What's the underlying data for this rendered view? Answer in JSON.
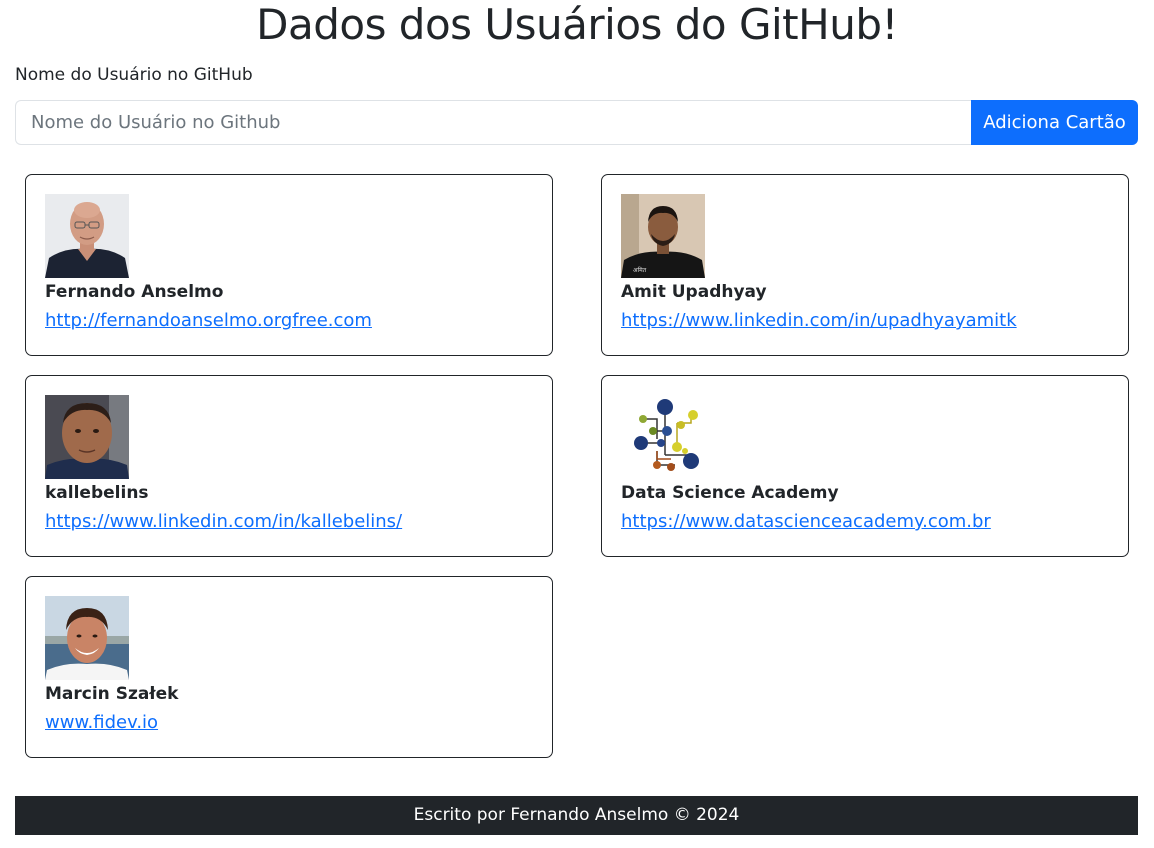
{
  "header": {
    "title": "Dados dos Usuários do GitHub!"
  },
  "form": {
    "label": "Nome do Usuário no GitHub",
    "input_placeholder": "Nome do Usuário no Github",
    "input_value": "",
    "add_button_label": "Adiciona Cartão"
  },
  "cards": [
    {
      "name": "Fernando Anselmo",
      "link": "http://fernandoanselmo.orgfree.com",
      "avatar": "avatar-photo-bald-man-glasses"
    },
    {
      "name": "Amit Upadhyay",
      "link": "https://www.linkedin.com/in/upadhyayamitk",
      "avatar": "avatar-photo-young-man"
    },
    {
      "name": "kallebelins",
      "link": "https://www.linkedin.com/in/kallebelins/",
      "avatar": "avatar-photo-man-closeup"
    },
    {
      "name": "Data Science Academy",
      "link": "https://www.datascienceacademy.com.br",
      "avatar": "molecule-network-logo"
    },
    {
      "name": "Marcin Szałek",
      "link": "www.fidev.io",
      "avatar": "avatar-photo-smiling-man-sea"
    }
  ],
  "footer": {
    "text": "Escrito por Fernando Anselmo © 2024"
  },
  "colors": {
    "primary": "#0d6efd",
    "text": "#212529",
    "footer_bg": "#212529",
    "input_border": "#dee2e6"
  }
}
